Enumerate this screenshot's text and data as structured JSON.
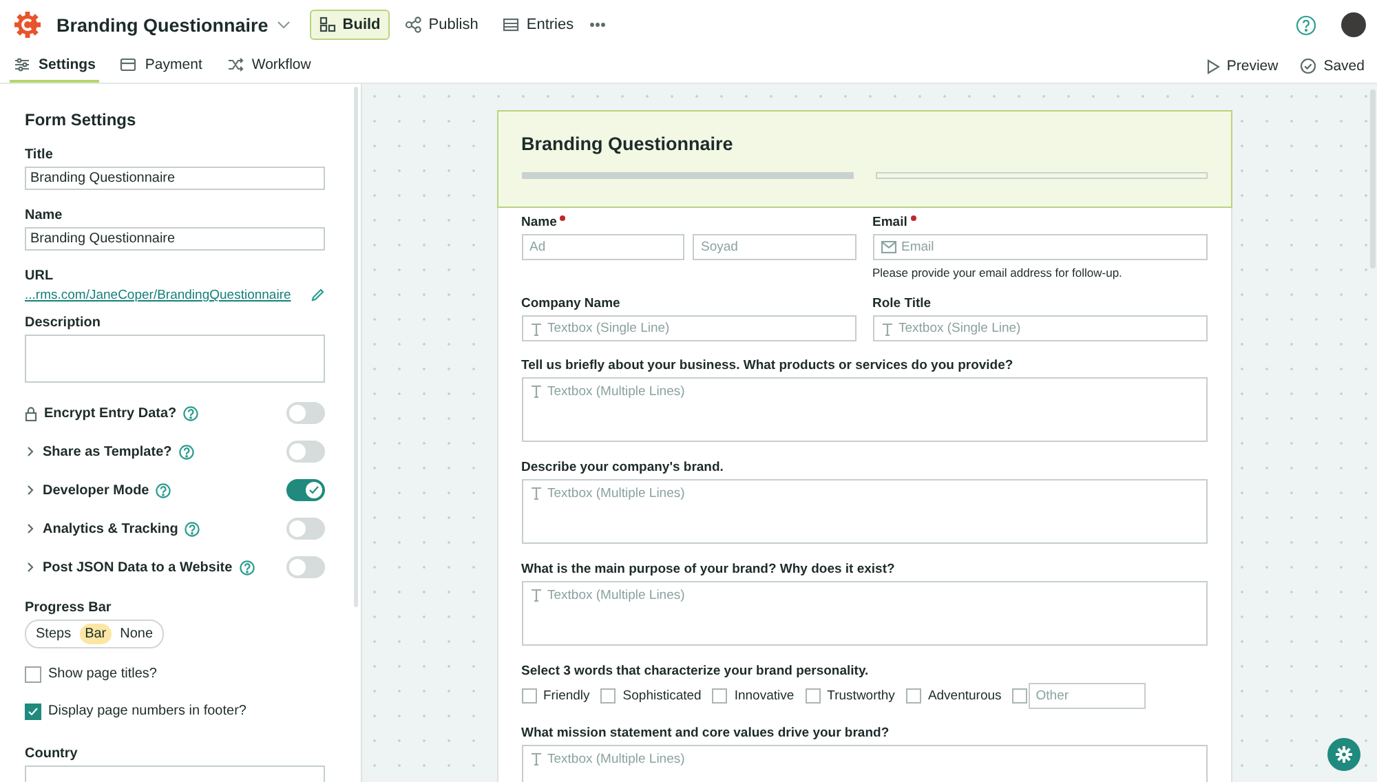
{
  "app": {
    "title": "Branding Questionnaire"
  },
  "top_nav": [
    {
      "label": "Build",
      "kind": "build",
      "selected": true
    },
    {
      "label": "Publish",
      "kind": "publish",
      "selected": false
    },
    {
      "label": "Entries",
      "kind": "entries",
      "selected": false
    }
  ],
  "sub_tabs": [
    {
      "label": "Settings",
      "kind": "settings",
      "selected": true
    },
    {
      "label": "Payment",
      "kind": "payment",
      "selected": false
    },
    {
      "label": "Workflow",
      "kind": "workflow",
      "selected": false
    }
  ],
  "actions": [
    {
      "label": "Preview",
      "kind": "preview"
    },
    {
      "label": "Saved",
      "kind": "saved"
    }
  ],
  "settings": {
    "heading": "Form Settings",
    "fields": [
      {
        "label": "Title",
        "value": "Branding Questionnaire"
      },
      {
        "label": "Name",
        "value": "Branding Questionnaire"
      }
    ],
    "url": {
      "label": "URL",
      "value": "...rms.com/JaneCoper/BrandingQuestionnaire"
    },
    "description": {
      "label": "Description"
    },
    "toggles": [
      {
        "label": "Encrypt Entry Data?",
        "kind": "lock",
        "on": false
      },
      {
        "label": "Share as Template?",
        "kind": "expand",
        "on": false
      },
      {
        "label": "Developer Mode",
        "kind": "expand",
        "on": true
      },
      {
        "label": "Analytics & Tracking",
        "kind": "expand",
        "on": false
      },
      {
        "label": "Post JSON Data to a Website",
        "kind": "expand",
        "on": false
      }
    ],
    "progress_bar": {
      "label": "Progress Bar",
      "options": [
        {
          "label": "Steps",
          "selected": false
        },
        {
          "label": "Bar",
          "selected": true
        },
        {
          "label": "None",
          "selected": false
        }
      ]
    },
    "checkboxes": [
      {
        "label": "Show page titles?",
        "checked": false
      },
      {
        "label": "Display page numbers in footer?",
        "checked": true
      }
    ],
    "country": {
      "label": "Country"
    }
  },
  "form": {
    "title": "Branding Questionnaire",
    "pages": [
      {
        "selected": true
      },
      {
        "selected": false
      }
    ],
    "rows": [
      {
        "fields": [
          {
            "kind": "name",
            "label": "Name",
            "required": true,
            "inputs": [
              {
                "placeholder": "Ad"
              },
              {
                "placeholder": "Soyad"
              }
            ]
          },
          {
            "kind": "email",
            "label": "Email",
            "required": true,
            "placeholder": "Email",
            "hint": "Please provide your email address for follow-up."
          }
        ]
      },
      {
        "fields": [
          {
            "kind": "text",
            "label": "Company Name",
            "required": false,
            "placeholder": "Textbox (Single Line)"
          },
          {
            "kind": "text",
            "label": "Role Title",
            "required": false,
            "placeholder": "Textbox (Single Line)"
          }
        ]
      },
      {
        "fields": [
          {
            "kind": "textarea",
            "label": "Tell us briefly about your business. What products or services do you provide?",
            "required": false,
            "placeholder": "Textbox (Multiple Lines)"
          }
        ]
      },
      {
        "fields": [
          {
            "kind": "textarea",
            "label": "Describe your company's brand.",
            "required": false,
            "placeholder": "Textbox (Multiple Lines)"
          }
        ]
      },
      {
        "fields": [
          {
            "kind": "textarea",
            "label": "What is the main purpose of your brand? Why does it exist?",
            "required": false,
            "placeholder": "Textbox (Multiple Lines)"
          }
        ]
      },
      {
        "fields": [
          {
            "kind": "checkboxes",
            "label": "Select 3 words that characterize your brand personality.",
            "required": false,
            "options": [
              {
                "label": "Friendly",
                "checked": false
              },
              {
                "label": "Sophisticated",
                "checked": false
              },
              {
                "label": "Innovative",
                "checked": false
              },
              {
                "label": "Trustworthy",
                "checked": false
              },
              {
                "label": "Adventurous",
                "checked": false
              }
            ],
            "other": {
              "placeholder": "Other",
              "checked": false
            }
          }
        ]
      },
      {
        "fields": [
          {
            "kind": "textarea",
            "label": "What mission statement and core values drive your brand?",
            "required": false,
            "placeholder": "Textbox (Multiple Lines)"
          }
        ]
      }
    ]
  }
}
